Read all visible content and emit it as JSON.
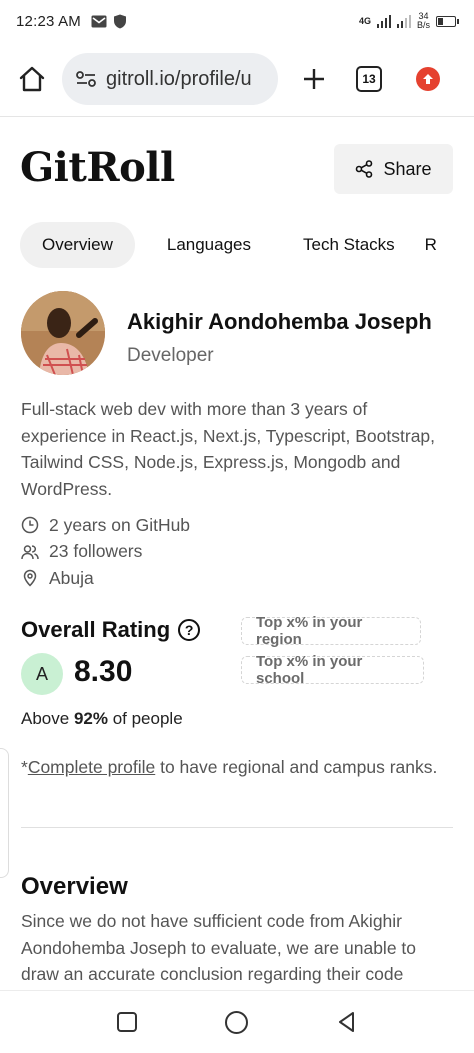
{
  "status_bar": {
    "time": "12:23 AM",
    "network": "4G",
    "net_speed_value": "34",
    "net_speed_unit": "B/s"
  },
  "browser": {
    "url": "gitroll.io/profile/u",
    "tab_count": "13",
    "accent_color": "#e5412f"
  },
  "header": {
    "brand": "GitRoll",
    "share_label": "Share"
  },
  "tabs": [
    {
      "label": "Overview",
      "active": true
    },
    {
      "label": "Languages",
      "active": false
    },
    {
      "label": "Tech Stacks",
      "active": false
    },
    {
      "label": "R",
      "active": false
    }
  ],
  "profile": {
    "name": "Akighir Aondohemba Joseph",
    "role": "Developer",
    "bio": "Full-stack web dev with more than 3 years of experience in React.js, Next.js, Typescript, Bootstrap, Tailwind CSS, Node.js, Express.js, Mongodb and WordPress.",
    "github_years": "2 years on GitHub",
    "followers": "23 followers",
    "location": "Abuja"
  },
  "rating": {
    "title": "Overall Rating",
    "help_icon_text": "?",
    "grade": "A",
    "score": "8.30",
    "grade_color": "#c9f0d3",
    "rank_region": "Top x% in your region",
    "rank_school": "Top x% in your school",
    "above_prefix": "Above ",
    "above_percent": "92%",
    "above_suffix": " of people"
  },
  "complete_note": {
    "prefix": "*",
    "link": "Complete profile",
    "suffix": " to have regional and campus ranks."
  },
  "overview": {
    "title": "Overview",
    "text": "Since we do not have sufficient code from Akighir Aondohemba Joseph to evaluate, we are unable to draw an accurate conclusion regarding their code"
  }
}
